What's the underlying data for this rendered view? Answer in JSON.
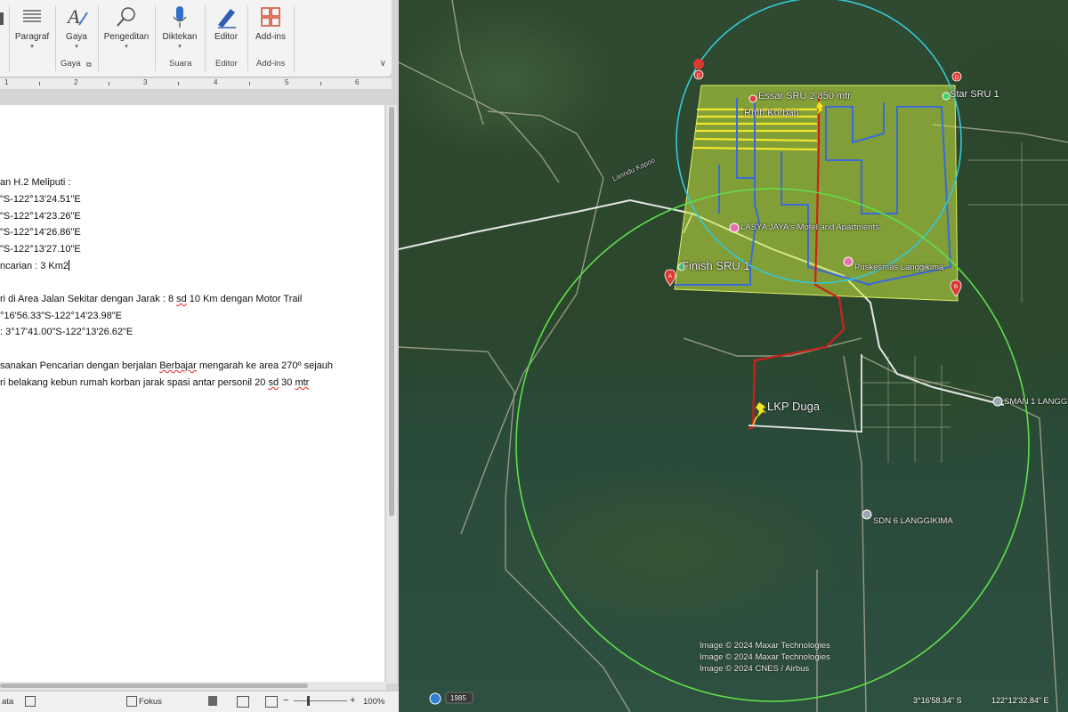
{
  "ribbon": {
    "buttons": {
      "paragraph": "Paragraf",
      "styles": "Gaya",
      "editing": "Pengeditan",
      "dictate": "Diktekan",
      "editor": "Editor",
      "addins": "Add-ins"
    },
    "groups": {
      "styles": "Gaya",
      "voice": "Suara",
      "editor": "Editor",
      "addins": "Add-ins"
    }
  },
  "ruler": {
    "numbers": [
      "1",
      "2",
      "3",
      "4",
      "5",
      "6"
    ]
  },
  "document": {
    "lines": {
      "l1": "an H.2 Meliputi :",
      "l2": "\"S-122°13'24.51\"E",
      "l3": "\"S-122°14'23.26\"E",
      "l4": "\"S-122°14'26.86\"E",
      "l5": "\"S-122°13'27.10\"E",
      "l6": "ncarian : 3 Km2",
      "l7a": "ri di Area Jalan Sekitar dengan Jarak : 8 ",
      "l7b": "sd",
      "l7c": " 10 Km dengan Motor Trail",
      "l8": "°16'56.33\"S-122°14'23.98\"E",
      "l9": ": 3°17'41.00\"S-122°13'26.62\"E",
      "l10a": "sanakan Pencarian dengan berjalan ",
      "l10b": "Berbajar",
      "l10c": " mengarah ke area 270º sejauh",
      "l11a": "ri belakang kebun rumah korban jarak spasi antar personil 20 ",
      "l11b": "sd",
      "l11c": " 30 ",
      "l11d": "mtr"
    }
  },
  "statusbar": {
    "data": "ata",
    "focus": "Fokus",
    "minus": "−",
    "plus": "+",
    "zoom": "100%"
  },
  "map": {
    "labels": {
      "essar": "Essar SRU 2 850 mtr",
      "rmh": "Rmh Korban",
      "star": "Star SRU 1",
      "lasyajaya": "LASYA JAYA's Motel and Apartments",
      "finish": "Finish SRU 1",
      "puskesmas": "Puskesmas Langgikima",
      "lkp": "LKP Duga",
      "sman": "SMAN 1 LANGG",
      "sdn": "SDN 6 LANGGIKIMA",
      "road": "Lanndu Kapoo"
    },
    "credits": [
      "Image © 2024 Maxar Technologies",
      "Image © 2024 Maxar Technologies",
      "Image © 2024 CNES / Airbus"
    ],
    "markers": {
      "a": "A",
      "b": "B",
      "c": "C",
      "d": "D"
    },
    "year": "1985",
    "lat": "3°16'58.34\" S",
    "lon": "122°12'32.84\" E",
    "colors": {
      "search_area": "#c8e640",
      "circle_cyan": "#35c8d6",
      "circle_green": "#5fe04a",
      "track_red": "#d0201a",
      "track_blue": "#3a6bd8",
      "track_yellow": "#f2e62c",
      "road": "#e6e6e6"
    }
  }
}
